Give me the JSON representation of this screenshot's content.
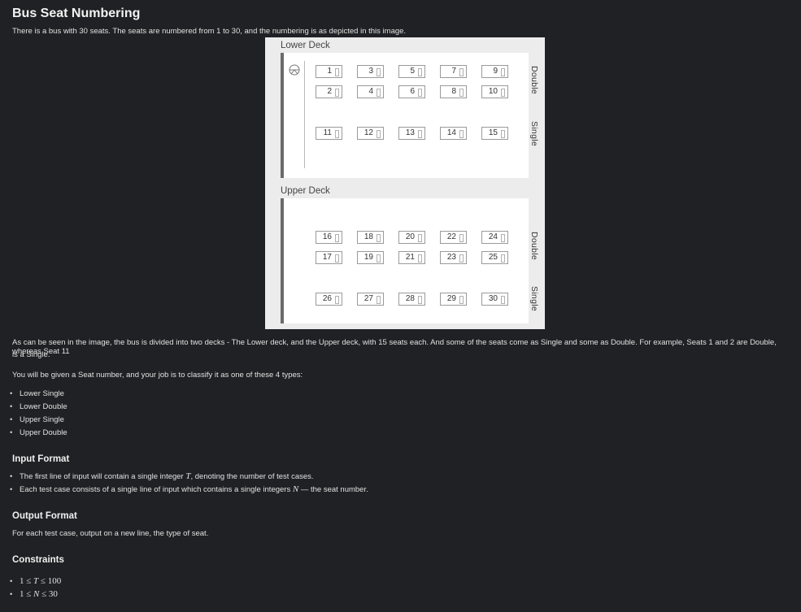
{
  "title": "Bus Seat Numbering",
  "intro": "There is a bus with 30 seats. The seats are numbered from 1 to 30, and the numbering is as depicted in this image.",
  "figure": {
    "lower_label": "Lower Deck",
    "upper_label": "Upper Deck",
    "double_label": "Double",
    "single_label": "Single",
    "lower_double_top": [
      "1",
      "3",
      "5",
      "7",
      "9"
    ],
    "lower_double_bottom": [
      "2",
      "4",
      "6",
      "8",
      "10"
    ],
    "lower_single": [
      "11",
      "12",
      "13",
      "14",
      "15"
    ],
    "upper_double_top": [
      "16",
      "18",
      "20",
      "22",
      "24"
    ],
    "upper_double_bottom": [
      "17",
      "19",
      "21",
      "23",
      "25"
    ],
    "upper_single": [
      "26",
      "27",
      "28",
      "29",
      "30"
    ],
    "steering_icon": "steering-wheel-icon"
  },
  "para1_line1": "As can be seen in the image, the bus is divided into two decks - The Lower deck, and the Upper deck, with 15 seats each. And some of the seats come as Single and some as Double. For example, Seats 1 and 2 are Double, whereas Seat 11",
  "para1_line2": "is a Single.",
  "para2": "You will be given a Seat number, and your job is to classify it as one of these 4 types:",
  "types": [
    "Lower Single",
    "Lower Double",
    "Upper Single",
    "Upper Double"
  ],
  "input_heading": "Input Format",
  "input": {
    "line1_pre": "The first line of input will contain a single integer ",
    "line1_var": "T",
    "line1_post": ", denoting the number of test cases.",
    "line2_pre": "Each test case consists of a single line of input which contains a single integers ",
    "line2_var": "N",
    "line2_post": " — the seat number."
  },
  "output_heading": "Output Format",
  "output_text": "For each test case, output on a new line, the type of seat.",
  "constraints_heading": "Constraints",
  "constraints": {
    "c1_lo": "1 ≤ ",
    "c1_var": "T",
    "c1_hi": " ≤ 100",
    "c2_lo": "1 ≤ ",
    "c2_var": "N",
    "c2_hi": " ≤ 30"
  }
}
